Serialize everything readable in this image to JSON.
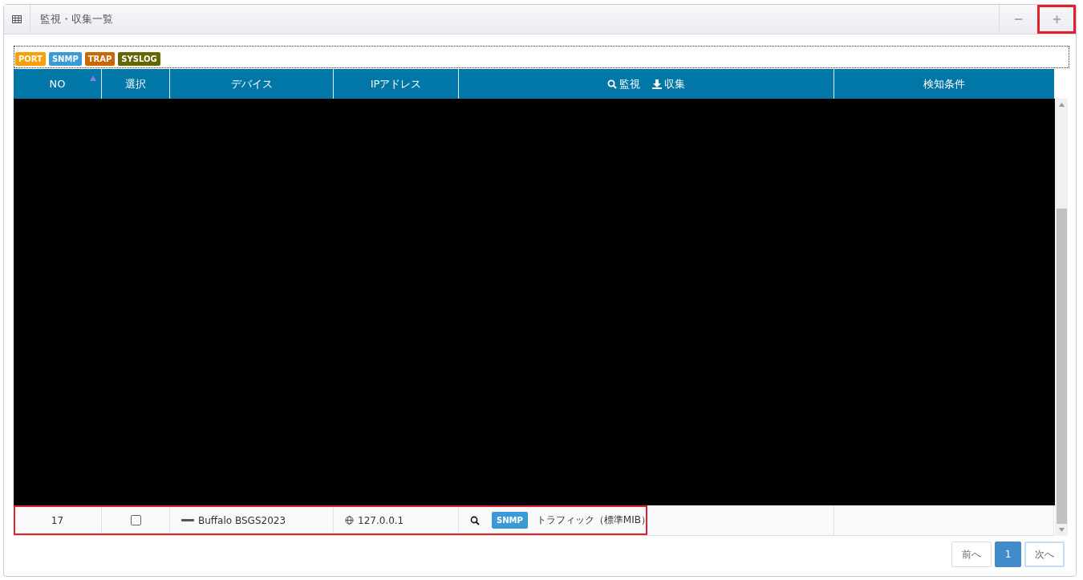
{
  "panel": {
    "title": "監視・収集一覧",
    "buttons": [
      {
        "label": "−",
        "highlighted": false
      },
      {
        "label": "+",
        "highlighted": true
      }
    ]
  },
  "legend": [
    {
      "label": "PORT",
      "color": "#f7a000"
    },
    {
      "label": "SNMP",
      "color": "#3a9ad6"
    },
    {
      "label": "TRAP",
      "color": "#cc6600"
    },
    {
      "label": "SYSLOG",
      "color": "#666600"
    }
  ],
  "table": {
    "columns": [
      {
        "label": "NO",
        "sorted": true
      },
      {
        "label": "選択",
        "sorted": false
      },
      {
        "label": "デバイス",
        "sorted": false
      },
      {
        "label": "IPアドレス",
        "sorted": false
      },
      {
        "sorted": false,
        "kind": "icons"
      },
      {
        "label": "検知条件",
        "sorted": false
      }
    ],
    "header_parts": [
      "監視",
      "収集"
    ],
    "rows": [
      {
        "no": "17",
        "checked": false,
        "device": "Buffalo BSGS2023",
        "ip": "127.0.0.1",
        "tag": "SNMP",
        "color": "#3a9ad6",
        "description": "トラフィック（標準MIB）",
        "highlighted": true
      }
    ]
  },
  "pagination": {
    "prev": "前へ",
    "pages": [
      {
        "label": "1",
        "selected": true
      }
    ],
    "next": "次へ"
  }
}
